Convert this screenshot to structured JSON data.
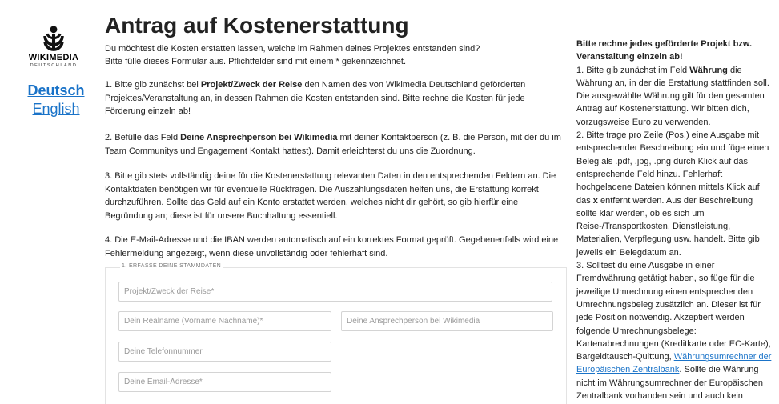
{
  "logo": {
    "name": "WIKIMEDIA",
    "sub": "DEUTSCHLAND"
  },
  "languages": {
    "de": "Deutsch",
    "en": "English"
  },
  "page": {
    "title": "Antrag auf Kostenerstattung",
    "intro": "Du möchtest die Kosten erstatten lassen, welche im Rahmen deines Projektes entstanden sind?",
    "intro2": "Bitte fülle dieses Formular aus. Pflichtfelder sind mit einem * gekennzeichnet."
  },
  "steps": {
    "s1": {
      "pre": "1. Bitte gib zunächst bei ",
      "bold": "Projekt/Zweck der Reise",
      "post": " den Namen des von Wikimedia Deutschland geförderten Projektes/Veranstaltung an, in dessen Rahmen die Kosten entstanden sind. Bitte rechne die Kosten für jede Förderung einzeln ab!"
    },
    "s2": {
      "pre": "2. Befülle das Feld ",
      "bold": "Deine Ansprechperson bei Wikimedia",
      "post": " mit deiner Kontaktperson (z. B. die Person, mit der du im Team Communitys und Engagement Kontakt hattest). Damit erleichterst du uns die Zuordnung."
    },
    "s3": "3. Bitte gib stets vollständig deine für die Kostenerstattung relevanten Daten in den entsprechenden Feldern an. Die Kontaktdaten benötigen wir für eventuelle Rückfragen. Die Auszahlungsdaten helfen uns, die Erstattung korrekt durchzuführen. Sollte das Geld auf ein Konto erstattet werden, welches nicht dir gehört, so gib hierfür eine Begründung an; diese ist für unsere Buchhaltung essentiell.",
    "s4": "4. Die E-Mail-Adresse und die IBAN werden automatisch auf ein korrektes Format geprüft. Gegebenenfalls wird eine Fehlermeldung angezeigt, wenn diese unvollständig oder fehlerhaft sind."
  },
  "form": {
    "legend": "1. ERFASSE DEINE STAMMDATEN",
    "project": {
      "placeholder": "Projekt/Zweck der Reise*",
      "value": ""
    },
    "realname": {
      "placeholder": "Dein Realname (Vorname Nachname)*",
      "value": ""
    },
    "contact": {
      "placeholder": "Deine Ansprechperson bei Wikimedia",
      "value": ""
    },
    "phone": {
      "placeholder": "Deine Telefonnummer",
      "value": ""
    },
    "email": {
      "placeholder": "Deine Email-Adresse*",
      "value": ""
    }
  },
  "sidebar": {
    "header": "Bitte rechne jedes geförderte Projekt bzw. Veranstaltung einzeln ab!",
    "p1_pre": "1. Bitte gib zunächst im Feld ",
    "p1_bold": "Währung",
    "p1_post": " die Währung an, in der die Erstattung stattfinden soll. Die ausgewählte Währung gilt für den gesamten Antrag auf Kostenerstattung. Wir bitten dich, vorzugsweise Euro zu verwenden.",
    "p2_pre": "2. Bitte trage pro Zeile (Pos.) eine Ausgabe mit entsprechender Beschreibung ein und füge einen Beleg als .pdf, .jpg, .png durch Klick auf das entsprechende Feld hinzu. Fehlerhaft hochgeladene Dateien können mittels Klick auf das ",
    "p2_bold": "x",
    "p2_post": " entfernt werden. Aus der Beschreibung sollte klar werden, ob es sich um Reise-/Transportkosten, Dienstleistung, Materialien, Verpflegung usw. handelt. Bitte gib jeweils ein Belegdatum an.",
    "p3_pre": "3. Solltest du eine Ausgabe in einer Fremdwährung getätigt haben, so füge für die jeweilige Umrechnung einen entsprechenden Umrechnungsbeleg zusätzlich an. Dieser ist für jede Position notwendig. Akzeptiert werden folgende Umrechnungsbelege: Kartenabrechnungen (Kreditkarte oder EC-Karte), Bargeldtausch-Quittung, ",
    "p3_link": "Währungsumrechner der Europäischen Zentralbank",
    "p3_post": ". Sollte die Währung nicht im Währungsumrechner der Europäischen Zentralbank vorhanden sein und auch kein"
  }
}
